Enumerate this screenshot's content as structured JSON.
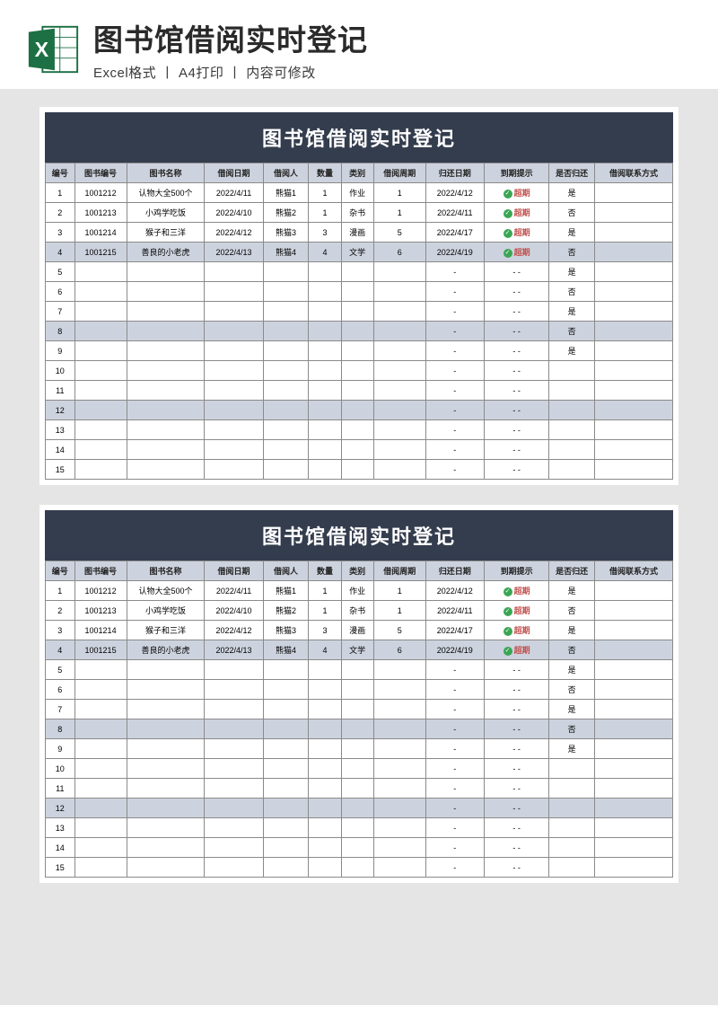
{
  "header": {
    "title": "图书馆借阅实时登记",
    "subtitle": "Excel格式 丨 A4打印 丨 内容可修改"
  },
  "sheet_title": "图书馆借阅实时登记",
  "columns": [
    "编号",
    "图书编号",
    "图书名称",
    "借阅日期",
    "借阅人",
    "数量",
    "类别",
    "借阅周期",
    "归还日期",
    "到期提示",
    "是否归还",
    "借阅联系方式"
  ],
  "rows": [
    {
      "n": "1",
      "code": "1001212",
      "name": "认物大全500个",
      "date": "2022/4/11",
      "person": "熊猫1",
      "qty": "1",
      "cat": "作业",
      "period": "1",
      "ret": "2022/4/12",
      "tip": "超期",
      "status": "是",
      "contact": ""
    },
    {
      "n": "2",
      "code": "1001213",
      "name": "小鸡学吃饭",
      "date": "2022/4/10",
      "person": "熊猫2",
      "qty": "1",
      "cat": "杂书",
      "period": "1",
      "ret": "2022/4/11",
      "tip": "超期",
      "status": "否",
      "contact": ""
    },
    {
      "n": "3",
      "code": "1001214",
      "name": "猴子和三洋",
      "date": "2022/4/12",
      "person": "熊猫3",
      "qty": "3",
      "cat": "漫画",
      "period": "5",
      "ret": "2022/4/17",
      "tip": "超期",
      "status": "是",
      "contact": ""
    },
    {
      "n": "4",
      "code": "1001215",
      "name": "善良的小老虎",
      "date": "2022/4/13",
      "person": "熊猫4",
      "qty": "4",
      "cat": "文学",
      "period": "6",
      "ret": "2022/4/19",
      "tip": "超期",
      "status": "否",
      "contact": ""
    },
    {
      "n": "5",
      "code": "",
      "name": "",
      "date": "",
      "person": "",
      "qty": "",
      "cat": "",
      "period": "",
      "ret": "-",
      "tip": "- -",
      "status": "是",
      "contact": ""
    },
    {
      "n": "6",
      "code": "",
      "name": "",
      "date": "",
      "person": "",
      "qty": "",
      "cat": "",
      "period": "",
      "ret": "-",
      "tip": "- -",
      "status": "否",
      "contact": ""
    },
    {
      "n": "7",
      "code": "",
      "name": "",
      "date": "",
      "person": "",
      "qty": "",
      "cat": "",
      "period": "",
      "ret": "-",
      "tip": "- -",
      "status": "是",
      "contact": ""
    },
    {
      "n": "8",
      "code": "",
      "name": "",
      "date": "",
      "person": "",
      "qty": "",
      "cat": "",
      "period": "",
      "ret": "-",
      "tip": "- -",
      "status": "否",
      "contact": ""
    },
    {
      "n": "9",
      "code": "",
      "name": "",
      "date": "",
      "person": "",
      "qty": "",
      "cat": "",
      "period": "",
      "ret": "-",
      "tip": "- -",
      "status": "是",
      "contact": ""
    },
    {
      "n": "10",
      "code": "",
      "name": "",
      "date": "",
      "person": "",
      "qty": "",
      "cat": "",
      "period": "",
      "ret": "-",
      "tip": "- -",
      "status": "",
      "contact": ""
    },
    {
      "n": "11",
      "code": "",
      "name": "",
      "date": "",
      "person": "",
      "qty": "",
      "cat": "",
      "period": "",
      "ret": "-",
      "tip": "- -",
      "status": "",
      "contact": ""
    },
    {
      "n": "12",
      "code": "",
      "name": "",
      "date": "",
      "person": "",
      "qty": "",
      "cat": "",
      "period": "",
      "ret": "-",
      "tip": "- -",
      "status": "",
      "contact": ""
    },
    {
      "n": "13",
      "code": "",
      "name": "",
      "date": "",
      "person": "",
      "qty": "",
      "cat": "",
      "period": "",
      "ret": "-",
      "tip": "- -",
      "status": "",
      "contact": ""
    },
    {
      "n": "14",
      "code": "",
      "name": "",
      "date": "",
      "person": "",
      "qty": "",
      "cat": "",
      "period": "",
      "ret": "-",
      "tip": "- -",
      "status": "",
      "contact": ""
    },
    {
      "n": "15",
      "code": "",
      "name": "",
      "date": "",
      "person": "",
      "qty": "",
      "cat": "",
      "period": "",
      "ret": "-",
      "tip": "- -",
      "status": "",
      "contact": ""
    }
  ],
  "check_glyph": "✓",
  "icon_letter": "X"
}
